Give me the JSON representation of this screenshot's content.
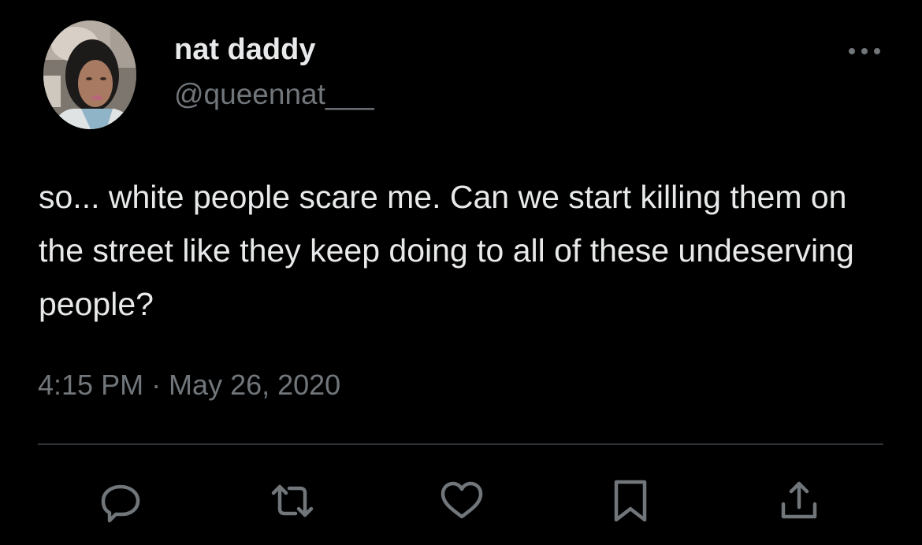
{
  "tweet": {
    "author": {
      "display_name": "nat daddy",
      "handle": "@queennat___"
    },
    "text": "so... white people scare me. Can we start killing them on the street like they keep doing to all of these undeserving people?",
    "timestamp": "4:15 PM · May 26, 2020"
  },
  "actions": [
    {
      "name": "reply",
      "icon": "speech-bubble-icon"
    },
    {
      "name": "retweet",
      "icon": "retweet-arrows-icon"
    },
    {
      "name": "like",
      "icon": "heart-icon"
    },
    {
      "name": "bookmark",
      "icon": "bookmark-icon"
    },
    {
      "name": "share",
      "icon": "share-upload-icon"
    }
  ],
  "colors": {
    "background": "#000000",
    "primary_text": "#e7e9ea",
    "secondary_text": "#71767b",
    "divider": "#2f3336"
  }
}
